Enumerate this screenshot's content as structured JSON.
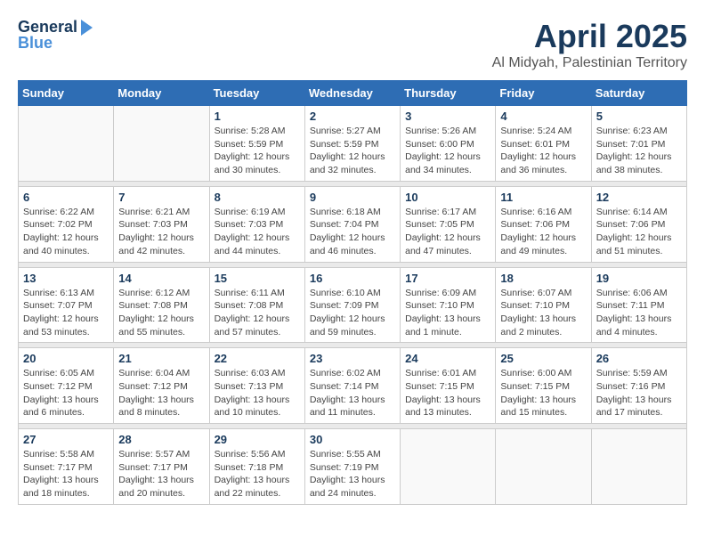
{
  "header": {
    "logo_line1": "General",
    "logo_line2": "Blue",
    "month": "April 2025",
    "location": "Al Midyah, Palestinian Territory"
  },
  "weekdays": [
    "Sunday",
    "Monday",
    "Tuesday",
    "Wednesday",
    "Thursday",
    "Friday",
    "Saturday"
  ],
  "weeks": [
    [
      {
        "day": "",
        "sunrise": "",
        "sunset": "",
        "daylight": ""
      },
      {
        "day": "",
        "sunrise": "",
        "sunset": "",
        "daylight": ""
      },
      {
        "day": "1",
        "sunrise": "Sunrise: 5:28 AM",
        "sunset": "Sunset: 5:59 PM",
        "daylight": "Daylight: 12 hours and 30 minutes."
      },
      {
        "day": "2",
        "sunrise": "Sunrise: 5:27 AM",
        "sunset": "Sunset: 5:59 PM",
        "daylight": "Daylight: 12 hours and 32 minutes."
      },
      {
        "day": "3",
        "sunrise": "Sunrise: 5:26 AM",
        "sunset": "Sunset: 6:00 PM",
        "daylight": "Daylight: 12 hours and 34 minutes."
      },
      {
        "day": "4",
        "sunrise": "Sunrise: 5:24 AM",
        "sunset": "Sunset: 6:01 PM",
        "daylight": "Daylight: 12 hours and 36 minutes."
      },
      {
        "day": "5",
        "sunrise": "Sunrise: 6:23 AM",
        "sunset": "Sunset: 7:01 PM",
        "daylight": "Daylight: 12 hours and 38 minutes."
      }
    ],
    [
      {
        "day": "6",
        "sunrise": "Sunrise: 6:22 AM",
        "sunset": "Sunset: 7:02 PM",
        "daylight": "Daylight: 12 hours and 40 minutes."
      },
      {
        "day": "7",
        "sunrise": "Sunrise: 6:21 AM",
        "sunset": "Sunset: 7:03 PM",
        "daylight": "Daylight: 12 hours and 42 minutes."
      },
      {
        "day": "8",
        "sunrise": "Sunrise: 6:19 AM",
        "sunset": "Sunset: 7:03 PM",
        "daylight": "Daylight: 12 hours and 44 minutes."
      },
      {
        "day": "9",
        "sunrise": "Sunrise: 6:18 AM",
        "sunset": "Sunset: 7:04 PM",
        "daylight": "Daylight: 12 hours and 46 minutes."
      },
      {
        "day": "10",
        "sunrise": "Sunrise: 6:17 AM",
        "sunset": "Sunset: 7:05 PM",
        "daylight": "Daylight: 12 hours and 47 minutes."
      },
      {
        "day": "11",
        "sunrise": "Sunrise: 6:16 AM",
        "sunset": "Sunset: 7:06 PM",
        "daylight": "Daylight: 12 hours and 49 minutes."
      },
      {
        "day": "12",
        "sunrise": "Sunrise: 6:14 AM",
        "sunset": "Sunset: 7:06 PM",
        "daylight": "Daylight: 12 hours and 51 minutes."
      }
    ],
    [
      {
        "day": "13",
        "sunrise": "Sunrise: 6:13 AM",
        "sunset": "Sunset: 7:07 PM",
        "daylight": "Daylight: 12 hours and 53 minutes."
      },
      {
        "day": "14",
        "sunrise": "Sunrise: 6:12 AM",
        "sunset": "Sunset: 7:08 PM",
        "daylight": "Daylight: 12 hours and 55 minutes."
      },
      {
        "day": "15",
        "sunrise": "Sunrise: 6:11 AM",
        "sunset": "Sunset: 7:08 PM",
        "daylight": "Daylight: 12 hours and 57 minutes."
      },
      {
        "day": "16",
        "sunrise": "Sunrise: 6:10 AM",
        "sunset": "Sunset: 7:09 PM",
        "daylight": "Daylight: 12 hours and 59 minutes."
      },
      {
        "day": "17",
        "sunrise": "Sunrise: 6:09 AM",
        "sunset": "Sunset: 7:10 PM",
        "daylight": "Daylight: 13 hours and 1 minute."
      },
      {
        "day": "18",
        "sunrise": "Sunrise: 6:07 AM",
        "sunset": "Sunset: 7:10 PM",
        "daylight": "Daylight: 13 hours and 2 minutes."
      },
      {
        "day": "19",
        "sunrise": "Sunrise: 6:06 AM",
        "sunset": "Sunset: 7:11 PM",
        "daylight": "Daylight: 13 hours and 4 minutes."
      }
    ],
    [
      {
        "day": "20",
        "sunrise": "Sunrise: 6:05 AM",
        "sunset": "Sunset: 7:12 PM",
        "daylight": "Daylight: 13 hours and 6 minutes."
      },
      {
        "day": "21",
        "sunrise": "Sunrise: 6:04 AM",
        "sunset": "Sunset: 7:12 PM",
        "daylight": "Daylight: 13 hours and 8 minutes."
      },
      {
        "day": "22",
        "sunrise": "Sunrise: 6:03 AM",
        "sunset": "Sunset: 7:13 PM",
        "daylight": "Daylight: 13 hours and 10 minutes."
      },
      {
        "day": "23",
        "sunrise": "Sunrise: 6:02 AM",
        "sunset": "Sunset: 7:14 PM",
        "daylight": "Daylight: 13 hours and 11 minutes."
      },
      {
        "day": "24",
        "sunrise": "Sunrise: 6:01 AM",
        "sunset": "Sunset: 7:15 PM",
        "daylight": "Daylight: 13 hours and 13 minutes."
      },
      {
        "day": "25",
        "sunrise": "Sunrise: 6:00 AM",
        "sunset": "Sunset: 7:15 PM",
        "daylight": "Daylight: 13 hours and 15 minutes."
      },
      {
        "day": "26",
        "sunrise": "Sunrise: 5:59 AM",
        "sunset": "Sunset: 7:16 PM",
        "daylight": "Daylight: 13 hours and 17 minutes."
      }
    ],
    [
      {
        "day": "27",
        "sunrise": "Sunrise: 5:58 AM",
        "sunset": "Sunset: 7:17 PM",
        "daylight": "Daylight: 13 hours and 18 minutes."
      },
      {
        "day": "28",
        "sunrise": "Sunrise: 5:57 AM",
        "sunset": "Sunset: 7:17 PM",
        "daylight": "Daylight: 13 hours and 20 minutes."
      },
      {
        "day": "29",
        "sunrise": "Sunrise: 5:56 AM",
        "sunset": "Sunset: 7:18 PM",
        "daylight": "Daylight: 13 hours and 22 minutes."
      },
      {
        "day": "30",
        "sunrise": "Sunrise: 5:55 AM",
        "sunset": "Sunset: 7:19 PM",
        "daylight": "Daylight: 13 hours and 24 minutes."
      },
      {
        "day": "",
        "sunrise": "",
        "sunset": "",
        "daylight": ""
      },
      {
        "day": "",
        "sunrise": "",
        "sunset": "",
        "daylight": ""
      },
      {
        "day": "",
        "sunrise": "",
        "sunset": "",
        "daylight": ""
      }
    ]
  ]
}
